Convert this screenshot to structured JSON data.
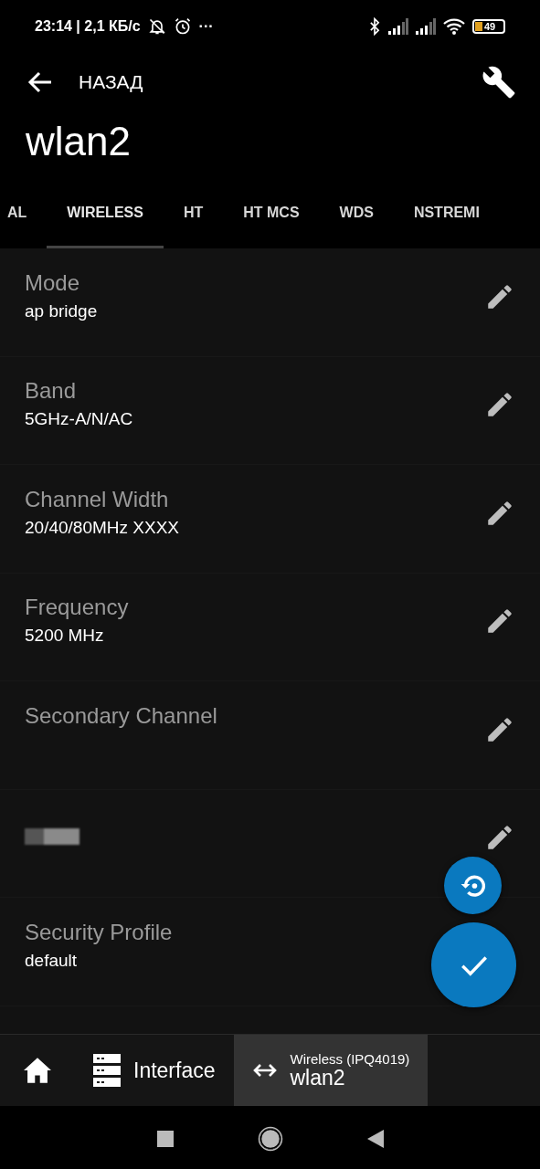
{
  "status_bar": {
    "time_speed": "23:14 | 2,1 КБ/с",
    "more": "···",
    "battery": "49"
  },
  "toolbar": {
    "back_label": "НАЗАД",
    "title": "wlan2"
  },
  "tabs": [
    {
      "label": "AL",
      "selected": false
    },
    {
      "label": "WIRELESS",
      "selected": true
    },
    {
      "label": "HT",
      "selected": false
    },
    {
      "label": "HT MCS",
      "selected": false
    },
    {
      "label": "WDS",
      "selected": false
    },
    {
      "label": "NSTREMI",
      "selected": false
    }
  ],
  "settings": [
    {
      "kind": "field",
      "label": "Mode",
      "value": "ap bridge",
      "edit_button": true
    },
    {
      "kind": "field",
      "label": "Band",
      "value": "5GHz-A/N/AC",
      "edit_button": true
    },
    {
      "kind": "field",
      "label": "Channel Width",
      "value": "20/40/80MHz XXXX",
      "edit_button": true
    },
    {
      "kind": "field",
      "label": "Frequency",
      "value": "5200 MHz",
      "edit_button": true
    },
    {
      "kind": "field",
      "label": "Secondary Channel",
      "edit_button": true
    },
    {
      "kind": "redacted",
      "edit_button": true
    },
    {
      "kind": "field",
      "label": "Security Profile",
      "value": "default",
      "edit_button": false
    }
  ],
  "bottom_nav": [
    {
      "kind": "home",
      "selected": false
    },
    {
      "kind": "crumb",
      "label": "Interface",
      "selected": false
    },
    {
      "kind": "current",
      "caption": "Wireless (IPQ4019)",
      "label": "wlan2",
      "selected": true
    }
  ]
}
